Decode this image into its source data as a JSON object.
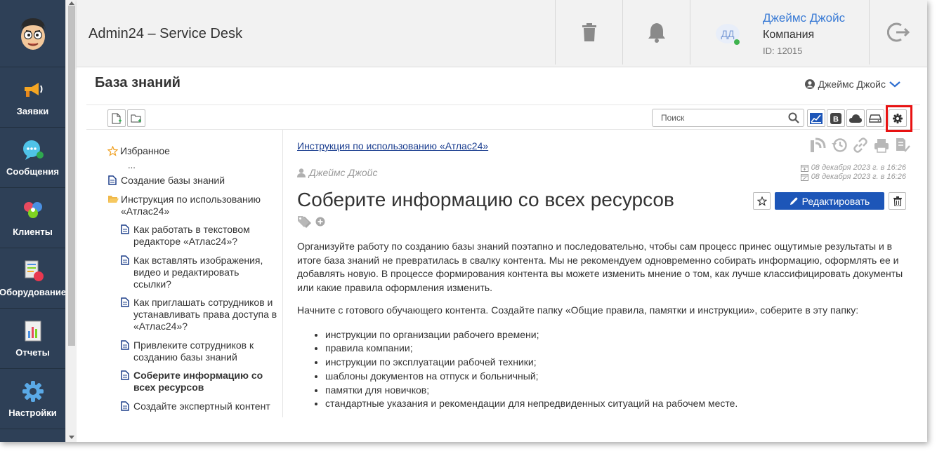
{
  "header": {
    "title": "Admin24 – Service Desk",
    "user": {
      "initials": "ДД",
      "name": "Джеймс Джойс",
      "company": "Компания",
      "id": "ID: 12015"
    }
  },
  "sidebar": {
    "items": [
      {
        "label": "Заявки",
        "icon": "megaphone-icon"
      },
      {
        "label": "Сообщения",
        "icon": "chat-bubble-icon"
      },
      {
        "label": "Клиенты",
        "icon": "clients-icon"
      },
      {
        "label": "Оборудование",
        "icon": "equipment-icon"
      },
      {
        "label": "Отчеты",
        "icon": "report-icon"
      },
      {
        "label": "Настройки",
        "icon": "gear-icon"
      }
    ]
  },
  "kb": {
    "title": "База знаний",
    "current_user": "Джеймс Джойс",
    "search_placeholder": "Поиск"
  },
  "tree": {
    "favorites": "Избранное",
    "ellipsis": "...",
    "items": [
      "Создание базы знаний",
      "Инструкция по использованию «Атлас24»",
      "Как работать в текстовом редакторе «Атлас24»?",
      "Как вставлять изображения, видео и редактировать ссылки?",
      "Как приглашать сотрудников и устанавливать права доступа в «Атлас24»?",
      "Привлеките сотрудников к созданию базы знаний",
      "Соберите информацию со всех ресурсов",
      "Создайте экспертный контент"
    ]
  },
  "article": {
    "breadcrumb": "Инструкция по использованию «Атлас24»",
    "author": "Джеймс Джойс",
    "created": "08 декабря 2023 г. в 16:26",
    "updated": "08 декабря 2023 г. в 16:26",
    "title": "Соберите информацию со всех ресурсов",
    "edit_label": "Редактировать",
    "paragraphs": [
      "Организуйте работу по созданию базы знаний поэтапно и последовательно, чтобы сам процесс принес ощутимые результаты и в итоге база знаний не превратилась в свалку контента. Мы не рекомендуем одновременно собирать информацию, оформлять ее и добавлять новую. В процессе формирования контента вы можете изменить мнение о том, как лучше классифицировать документы или какие правила оформления изменить.",
      "Начните с готового обучающего контента. Создайте папку «Общие правила, памятки и инструкции», соберите в эту папку:"
    ],
    "list": [
      "инструкции по организации рабочего времени;",
      "правила компании;",
      "инструкции по эксплуатации рабочей техники;",
      "шаблоны документов на отпуск и больничный;",
      "памятки для новичков;",
      "стандартные указания и рекомендации для непредвиденных ситуаций на рабочем месте."
    ]
  },
  "colors": {
    "sidebar": "#2e4057",
    "accent": "#1d56b8",
    "link": "#3a7bd5",
    "highlight": "#e81212"
  }
}
